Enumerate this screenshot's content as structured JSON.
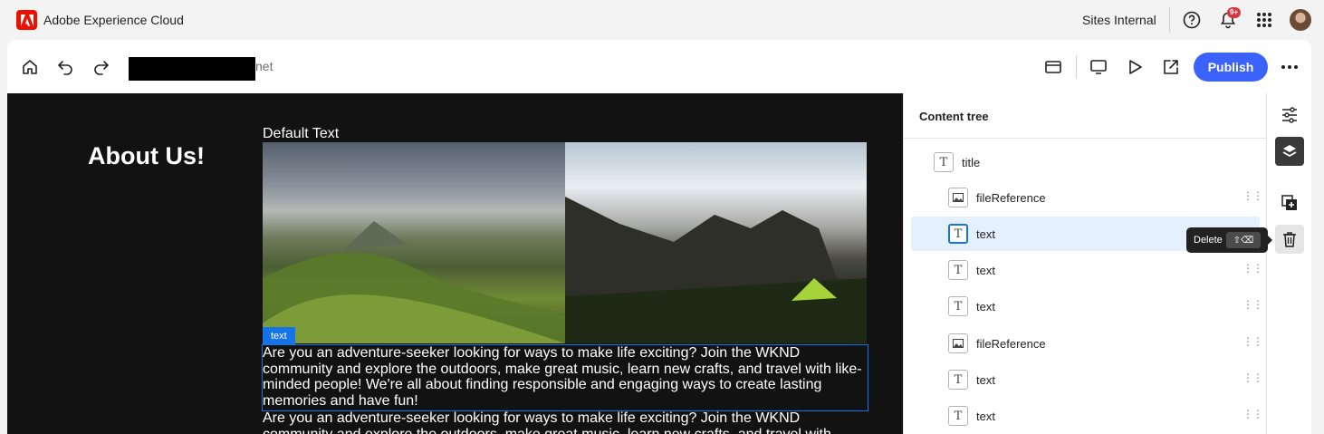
{
  "shell": {
    "app_title": "Adobe Experience Cloud",
    "org_name": "Sites Internal",
    "notification_badge": "9+"
  },
  "toolbar": {
    "url_suffix": "net",
    "publish_label": "Publish"
  },
  "canvas": {
    "heading": "About Us!",
    "default_text": "Default Text",
    "selected_tag": "text",
    "paragraph_selected": "Are you an adventure-seeker looking for ways to make life exciting? Join the WKND community and explore the outdoors, make great music, learn new crafts, and travel with like-minded people! We're all about finding responsible and engaging ways to create lasting memories and have fun!",
    "paragraph_next": "Are you an adventure-seeker looking for ways to make life exciting? Join the WKND community and explore the outdoors, make great music, learn new crafts, and travel with"
  },
  "panel": {
    "title": "Content tree",
    "items": [
      {
        "label": "title",
        "icon": "text-icon"
      },
      {
        "label": "fileReference",
        "icon": "image-icon"
      },
      {
        "label": "text",
        "icon": "text-icon",
        "selected": true
      },
      {
        "label": "text",
        "icon": "text-icon"
      },
      {
        "label": "text",
        "icon": "text-icon"
      },
      {
        "label": "fileReference",
        "icon": "image-icon"
      },
      {
        "label": "text",
        "icon": "text-icon"
      },
      {
        "label": "text",
        "icon": "text-icon"
      }
    ]
  },
  "tooltip": {
    "label": "Delete",
    "shortcut": "⇧⌫"
  },
  "colors": {
    "accent": "#3b63fb",
    "selection": "#1473e6",
    "adobe_red": "#eb1000",
    "canvas_bg": "#121212"
  }
}
